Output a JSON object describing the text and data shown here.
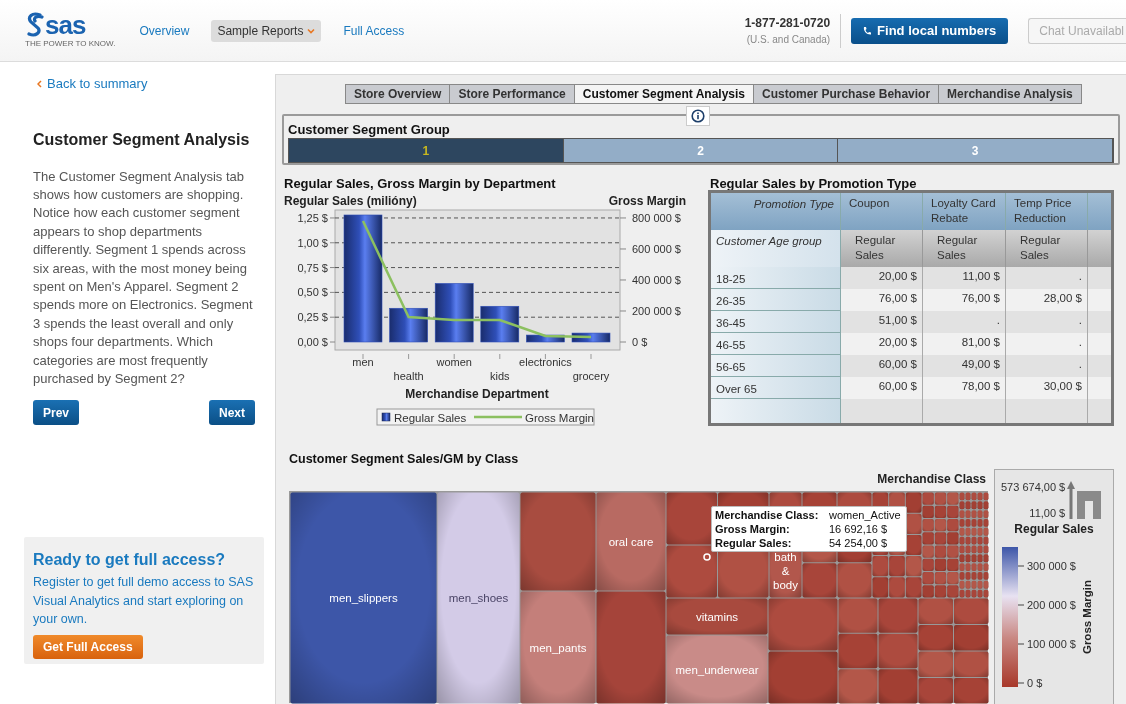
{
  "header": {
    "logo": "sas",
    "tagline": "THE POWER TO KNOW.",
    "nav": [
      {
        "label": "Overview",
        "selected": false,
        "has_menu": false
      },
      {
        "label": "Sample Reports",
        "selected": true,
        "has_menu": true
      },
      {
        "label": "Full Access",
        "selected": false,
        "has_menu": false
      }
    ],
    "phone": "1-877-281-0720",
    "phone_note": "(U.S. and Canada)",
    "find_button": "Find local numbers",
    "chat_button": {
      "label": "Chat Unavailabl",
      "disabled": true
    }
  },
  "sidebar": {
    "back_link": "Back to summary",
    "title": "Customer Segment Analysis",
    "body": "The Customer Segment Analysis tab shows how customers are shopping. Notice how each customer segment appears to shop departments differently. Segment 1 spends across six areas, with the most money being spent on Men's Apparel. Segment 2 spends more on Electronics. Segment 3 spends the least overall and only shops four departments. Which categories are most frequently purchased by Segment 2?",
    "nav_buttons": [
      "Prev",
      "Next"
    ],
    "promo": {
      "title": "Ready to get full access?",
      "text": "Register to get full demo access to SAS Visual Analytics and start exploring on your own.",
      "button": "Get Full Access"
    }
  },
  "report": {
    "tabs": [
      {
        "label": "Store Overview",
        "selected": false
      },
      {
        "label": "Store Performance",
        "selected": false
      },
      {
        "label": "Customer Segment Analysis",
        "selected": true
      },
      {
        "label": "Customer Purchase Behavior",
        "selected": false
      },
      {
        "label": "Merchandise Analysis",
        "selected": false
      }
    ],
    "segment_group": {
      "title": "Customer Segment Group",
      "segments": [
        {
          "label": "1",
          "selected": true
        },
        {
          "label": "2",
          "selected": false
        },
        {
          "label": "3",
          "selected": false
        }
      ]
    },
    "bar_chart": {
      "chart_data": {
        "type": "bar",
        "title": "Regular Sales, Gross Margin by Department",
        "xlabel": "Merchandise Department",
        "ylabel": "Regular Sales (milióny)",
        "y2label": "Gross Margin",
        "categories": [
          "men",
          "health",
          "women",
          "kids",
          "electronics",
          "grocery"
        ],
        "series": [
          {
            "name": "Regular Sales",
            "type": "bar",
            "color": "#2f4fb8",
            "values": [
              1.28,
              0.34,
              0.59,
              0.36,
              0.07,
              0.09
            ]
          },
          {
            "name": "Gross Margin",
            "type": "line",
            "axis": "y2",
            "color": "#8cc060",
            "values": [
              780000,
              161000,
              142000,
              142000,
              39000,
              32000
            ]
          }
        ],
        "ylim": [
          0,
          1.3
        ],
        "y2lim": [
          0,
          832000
        ],
        "grid": true,
        "legend": true,
        "yticks": [
          {
            "value": 0,
            "label": "0,00 $"
          },
          {
            "value": 0.25,
            "label": "0,25 $"
          },
          {
            "value": 0.5,
            "label": "0,50 $"
          },
          {
            "value": 0.75,
            "label": "0,75 $"
          },
          {
            "value": 1,
            "label": "1,00 $"
          },
          {
            "value": 1.25,
            "label": "1,25 $"
          }
        ],
        "y2ticks": [
          {
            "value": 0,
            "label": "0 $"
          },
          {
            "value": 200000,
            "label": "200 000 $"
          },
          {
            "value": 400000,
            "label": "400 000 $"
          },
          {
            "value": 600000,
            "label": "600 000 $"
          },
          {
            "value": 800000,
            "label": "800 000 $"
          }
        ]
      }
    },
    "table": {
      "title": "Regular Sales by Promotion Type",
      "corner_top": "Promotion Type",
      "corner_bottom": "Customer Age group",
      "columns": [
        "Coupon",
        "Loyalty Card Rebate",
        "Temp Price Reduction"
      ],
      "subheaders": [
        "Regular Sales",
        "Regular Sales",
        "Regular Sales"
      ],
      "rows": [
        {
          "label": "18-25",
          "cells": [
            "20,00 $",
            "11,00 $",
            "."
          ]
        },
        {
          "label": "26-35",
          "cells": [
            "76,00 $",
            "76,00 $",
            "28,00 $"
          ]
        },
        {
          "label": "36-45",
          "cells": [
            "51,00 $",
            ".",
            "."
          ]
        },
        {
          "label": "46-55",
          "cells": [
            "20,00 $",
            "81,00 $",
            "."
          ]
        },
        {
          "label": "56-65",
          "cells": [
            "60,00 $",
            "49,00 $",
            "."
          ]
        },
        {
          "label": "Over 65",
          "cells": [
            "60,00 $",
            "78,00 $",
            "30,00 $"
          ]
        }
      ]
    },
    "treemap": {
      "title": "Customer Segment Sales/GM by Class",
      "level_label": "Merchandise Class",
      "tiles": [
        {
          "label": "men_slippers",
          "color": "#3d56a8"
        },
        {
          "label": "men_shoes",
          "color": "#d3cbe7"
        },
        {
          "label": "oral care",
          "color": "#b86a62"
        },
        {
          "label": "men_pants",
          "color": "#c47f7a"
        },
        {
          "label": "bath & body",
          "color": "#b2574c"
        },
        {
          "label": "vitamins",
          "color": "#a84a3e"
        },
        {
          "label": "men_underwear",
          "color": "#c98b88"
        }
      ],
      "tooltip": [
        {
          "label": "Merchandise Class:",
          "value": "women_Active"
        },
        {
          "label": "Gross Margin:",
          "value": "16 692,16 $"
        },
        {
          "label": "Regular Sales:",
          "value": "54 254,00 $"
        }
      ],
      "size_legend": {
        "max": "573 674,00 $",
        "min": "11,00 $",
        "title": "Regular Sales"
      },
      "color_legend": {
        "title": "Gross Margin",
        "ticks": [
          "300 000 $",
          "200 000 $",
          "100 000 $",
          "0 $"
        ]
      }
    }
  }
}
